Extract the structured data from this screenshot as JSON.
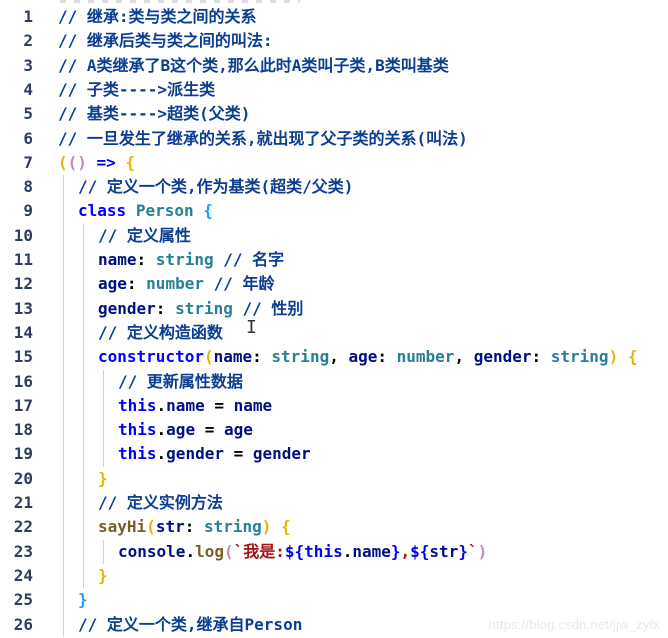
{
  "lines": [
    {
      "n": "1",
      "indent": 0,
      "tokens": [
        {
          "t": "// 继承:类与类之间的关系",
          "c": "comment"
        }
      ]
    },
    {
      "n": "2",
      "indent": 0,
      "tokens": [
        {
          "t": "// 继承后类与类之间的叫法:",
          "c": "comment"
        }
      ]
    },
    {
      "n": "3",
      "indent": 0,
      "tokens": [
        {
          "t": "// A类继承了B这个类,那么此时A类叫子类,B类叫基类",
          "c": "comment"
        }
      ]
    },
    {
      "n": "4",
      "indent": 0,
      "tokens": [
        {
          "t": "// 子类---->派生类",
          "c": "comment"
        }
      ]
    },
    {
      "n": "5",
      "indent": 0,
      "tokens": [
        {
          "t": "// 基类---->超类(父类)",
          "c": "comment"
        }
      ]
    },
    {
      "n": "6",
      "indent": 0,
      "tokens": [
        {
          "t": "// 一旦发生了继承的关系,就出现了父子类的关系(叫法)",
          "c": "comment"
        }
      ]
    },
    {
      "n": "7",
      "indent": 0,
      "tokens": [
        {
          "t": "(",
          "c": "bracket"
        },
        {
          "t": "()",
          "c": "bracket2"
        },
        {
          "t": " ",
          "c": "plain"
        },
        {
          "t": "=>",
          "c": "keyword"
        },
        {
          "t": " ",
          "c": "plain"
        },
        {
          "t": "{",
          "c": "bracket"
        }
      ]
    },
    {
      "n": "8",
      "indent": 1,
      "tokens": [
        {
          "t": "// 定义一个类,作为基类(超类/父类)",
          "c": "comment"
        }
      ]
    },
    {
      "n": "9",
      "indent": 1,
      "tokens": [
        {
          "t": "class",
          "c": "keyword"
        },
        {
          "t": " ",
          "c": "plain"
        },
        {
          "t": "Person",
          "c": "class"
        },
        {
          "t": " ",
          "c": "plain"
        },
        {
          "t": "{",
          "c": "bracket3"
        }
      ]
    },
    {
      "n": "10",
      "indent": 2,
      "tokens": [
        {
          "t": "// 定义属性",
          "c": "comment"
        }
      ]
    },
    {
      "n": "11",
      "indent": 2,
      "tokens": [
        {
          "t": "name",
          "c": "prop"
        },
        {
          "t": ": ",
          "c": "plain"
        },
        {
          "t": "string",
          "c": "type"
        },
        {
          "t": " ",
          "c": "plain"
        },
        {
          "t": "// 名字",
          "c": "comment"
        }
      ]
    },
    {
      "n": "12",
      "indent": 2,
      "tokens": [
        {
          "t": "age",
          "c": "prop"
        },
        {
          "t": ": ",
          "c": "plain"
        },
        {
          "t": "number",
          "c": "type"
        },
        {
          "t": " ",
          "c": "plain"
        },
        {
          "t": "// 年龄",
          "c": "comment"
        }
      ]
    },
    {
      "n": "13",
      "indent": 2,
      "tokens": [
        {
          "t": "gender",
          "c": "prop"
        },
        {
          "t": ": ",
          "c": "plain"
        },
        {
          "t": "string",
          "c": "type"
        },
        {
          "t": " ",
          "c": "plain"
        },
        {
          "t": "// 性别",
          "c": "comment"
        }
      ]
    },
    {
      "n": "14",
      "indent": 2,
      "tokens": [
        {
          "t": "// 定义构造函数",
          "c": "comment"
        }
      ]
    },
    {
      "n": "15",
      "indent": 2,
      "tokens": [
        {
          "t": "constructor",
          "c": "keyword"
        },
        {
          "t": "(",
          "c": "bracket"
        },
        {
          "t": "name",
          "c": "ident"
        },
        {
          "t": ": ",
          "c": "plain"
        },
        {
          "t": "string",
          "c": "type"
        },
        {
          "t": ", ",
          "c": "plain"
        },
        {
          "t": "age",
          "c": "ident"
        },
        {
          "t": ": ",
          "c": "plain"
        },
        {
          "t": "number",
          "c": "type"
        },
        {
          "t": ", ",
          "c": "plain"
        },
        {
          "t": "gender",
          "c": "ident"
        },
        {
          "t": ": ",
          "c": "plain"
        },
        {
          "t": "string",
          "c": "type"
        },
        {
          "t": ")",
          "c": "bracket"
        },
        {
          "t": " ",
          "c": "plain"
        },
        {
          "t": "{",
          "c": "bracket"
        }
      ]
    },
    {
      "n": "16",
      "indent": 3,
      "tokens": [
        {
          "t": "// 更新属性数据",
          "c": "comment"
        }
      ]
    },
    {
      "n": "17",
      "indent": 3,
      "tokens": [
        {
          "t": "this",
          "c": "this"
        },
        {
          "t": ".",
          "c": "plain"
        },
        {
          "t": "name",
          "c": "prop"
        },
        {
          "t": " = ",
          "c": "plain"
        },
        {
          "t": "name",
          "c": "ident"
        }
      ]
    },
    {
      "n": "18",
      "indent": 3,
      "tokens": [
        {
          "t": "this",
          "c": "this"
        },
        {
          "t": ".",
          "c": "plain"
        },
        {
          "t": "age",
          "c": "prop"
        },
        {
          "t": " = ",
          "c": "plain"
        },
        {
          "t": "age",
          "c": "ident"
        }
      ]
    },
    {
      "n": "19",
      "indent": 3,
      "tokens": [
        {
          "t": "this",
          "c": "this"
        },
        {
          "t": ".",
          "c": "plain"
        },
        {
          "t": "gender",
          "c": "prop"
        },
        {
          "t": " = ",
          "c": "plain"
        },
        {
          "t": "gender",
          "c": "ident"
        }
      ]
    },
    {
      "n": "20",
      "indent": 2,
      "tokens": [
        {
          "t": "}",
          "c": "bracket"
        }
      ]
    },
    {
      "n": "21",
      "indent": 2,
      "tokens": [
        {
          "t": "// 定义实例方法",
          "c": "comment"
        }
      ]
    },
    {
      "n": "22",
      "indent": 2,
      "tokens": [
        {
          "t": "sayHi",
          "c": "method"
        },
        {
          "t": "(",
          "c": "bracket"
        },
        {
          "t": "str",
          "c": "ident"
        },
        {
          "t": ": ",
          "c": "plain"
        },
        {
          "t": "string",
          "c": "type"
        },
        {
          "t": ")",
          "c": "bracket"
        },
        {
          "t": " ",
          "c": "plain"
        },
        {
          "t": "{",
          "c": "bracket"
        }
      ]
    },
    {
      "n": "23",
      "indent": 3,
      "tokens": [
        {
          "t": "console",
          "c": "ident"
        },
        {
          "t": ".",
          "c": "plain"
        },
        {
          "t": "log",
          "c": "method"
        },
        {
          "t": "(",
          "c": "bracket2"
        },
        {
          "t": "`我是:",
          "c": "string"
        },
        {
          "t": "${",
          "c": "templ"
        },
        {
          "t": "this",
          "c": "this"
        },
        {
          "t": ".",
          "c": "plain"
        },
        {
          "t": "name",
          "c": "prop"
        },
        {
          "t": "}",
          "c": "templ"
        },
        {
          "t": ",",
          "c": "string"
        },
        {
          "t": "${",
          "c": "templ"
        },
        {
          "t": "str",
          "c": "ident"
        },
        {
          "t": "}",
          "c": "templ"
        },
        {
          "t": "`",
          "c": "string"
        },
        {
          "t": ")",
          "c": "bracket2"
        }
      ]
    },
    {
      "n": "24",
      "indent": 2,
      "tokens": [
        {
          "t": "}",
          "c": "bracket"
        }
      ]
    },
    {
      "n": "25",
      "indent": 1,
      "tokens": [
        {
          "t": "}",
          "c": "bracket3"
        }
      ]
    },
    {
      "n": "26",
      "indent": 1,
      "tokens": [
        {
          "t": "// 定义一个类,继承自Person",
          "c": "comment"
        }
      ]
    }
  ],
  "watermark": "https://blog.csdn.net/jjw_zyfx",
  "cursor_glyph": "I"
}
